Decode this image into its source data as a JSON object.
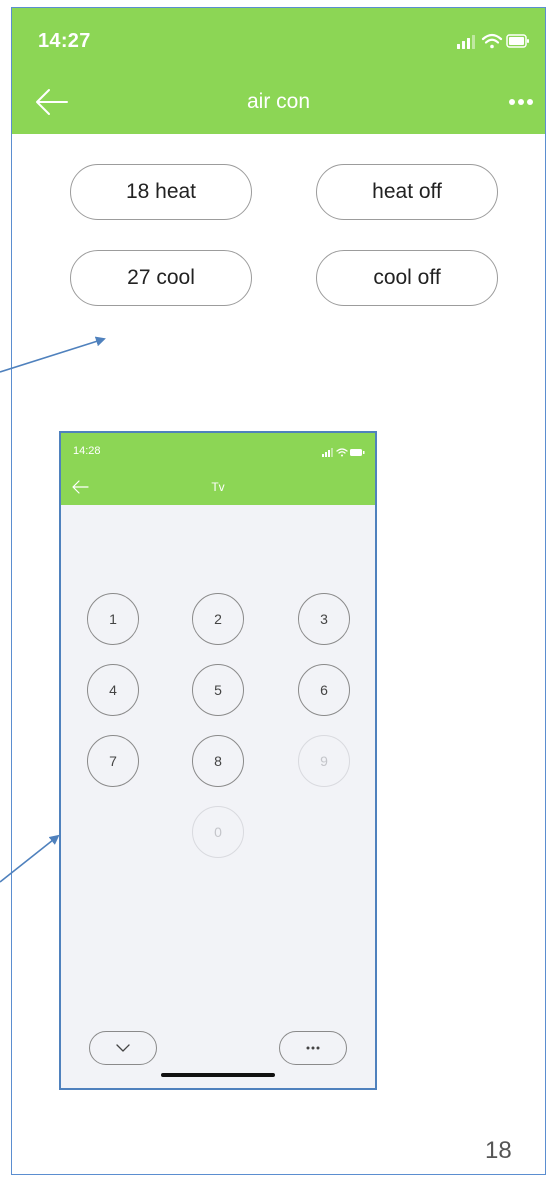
{
  "main": {
    "status_time": "14:27",
    "title": "air con",
    "buttons": [
      {
        "label": "18 heat"
      },
      {
        "label": "heat off"
      },
      {
        "label": "27 cool"
      },
      {
        "label": "cool off"
      }
    ],
    "accent_color": "#8cd655"
  },
  "inset": {
    "status_time": "14:28",
    "title": "Tv",
    "keypad": [
      {
        "label": "1",
        "enabled": true
      },
      {
        "label": "2",
        "enabled": true
      },
      {
        "label": "3",
        "enabled": true
      },
      {
        "label": "4",
        "enabled": true
      },
      {
        "label": "5",
        "enabled": true
      },
      {
        "label": "6",
        "enabled": true
      },
      {
        "label": "7",
        "enabled": true
      },
      {
        "label": "8",
        "enabled": true
      },
      {
        "label": "9",
        "enabled": false
      },
      {
        "label": "0",
        "enabled": false
      }
    ],
    "bottom_buttons": [
      {
        "icon": "chevron-down-icon"
      },
      {
        "icon": "more-horizontal-icon"
      }
    ]
  },
  "page_number": "18",
  "icons": {
    "back": "arrow-left-icon",
    "more": "more-horizontal-icon",
    "signal": "signal-icon",
    "wifi": "wifi-icon",
    "battery": "battery-icon"
  },
  "colors": {
    "header_green": "#8cd655",
    "frame_blue": "#5b8ed0",
    "arrow_blue": "#4f81bd"
  }
}
